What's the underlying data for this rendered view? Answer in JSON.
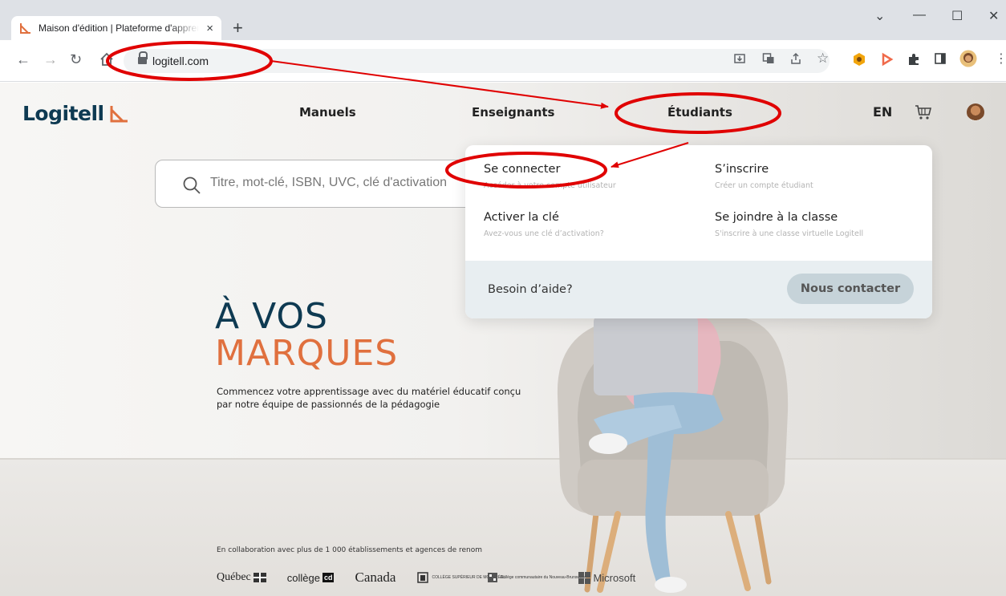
{
  "browser": {
    "tab_title": "Maison d'édition | Plateforme d'apprentissage",
    "tab_close": "×",
    "new_tab": "+",
    "url": "logitell.com",
    "window_controls": {
      "minimize_dropdown": "⌄",
      "minimize": "—",
      "maximize": "☐",
      "close": "✕"
    }
  },
  "header": {
    "logo_text": "Logitell",
    "nav": [
      "Manuels",
      "Enseignants",
      "Étudiants"
    ],
    "lang": "EN"
  },
  "search": {
    "placeholder": "Titre, mot-clé, ISBN, UVC, clé d'activation"
  },
  "dropdown": {
    "items": [
      {
        "label": "Se connecter",
        "desc": "Accéder à votre compte utilisateur"
      },
      {
        "label": "S’inscrire",
        "desc": "Créer un compte étudiant"
      },
      {
        "label": "Activer la clé",
        "desc": "Avez-vous une clé d’activation?"
      },
      {
        "label": "Se joindre à la classe",
        "desc": "S'inscrire à une classe virtuelle Logitell"
      }
    ],
    "help": "Besoin d’aide?",
    "contact": "Nous contacter"
  },
  "hero": {
    "title_line1": "À VOS",
    "title_line2": "MARQUES",
    "subtitle": "Commencez votre apprentissage avec du matériel éducatif conçu par notre équipe de passionnés de la pédagogie"
  },
  "partners": {
    "intro": "En collaboration avec plus de 1 000 établissements et agences de renom",
    "quebec": "Québec",
    "college": "collège",
    "college_badge": "cd",
    "canada": "Canada",
    "college_superieur": "COLLÈGE SUPÉRIEUR DE MONTRÉAL",
    "college_communautaire": "Collège communautaire du Nouveau-Brunswick",
    "microsoft": "Microsoft"
  },
  "colors": {
    "brand_navy": "#0e3a52",
    "brand_orange": "#e0703e",
    "annotation_red": "#e00000"
  }
}
